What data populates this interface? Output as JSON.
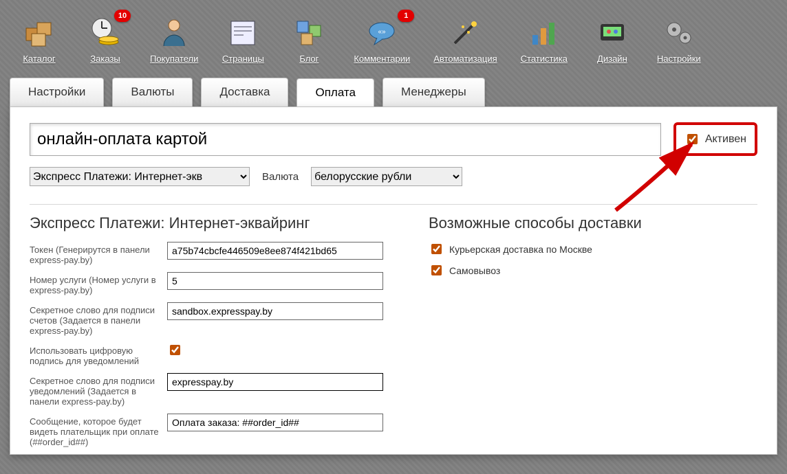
{
  "topnav": [
    {
      "label": "Каталог",
      "badge": null
    },
    {
      "label": "Заказы",
      "badge": "10"
    },
    {
      "label": "Покупатели",
      "badge": null
    },
    {
      "label": "Страницы",
      "badge": null
    },
    {
      "label": "Блог",
      "badge": null
    },
    {
      "label": "Комментарии",
      "badge": "1"
    },
    {
      "label": "Автоматизация",
      "badge": null
    },
    {
      "label": "Статистика",
      "badge": null
    },
    {
      "label": "Дизайн",
      "badge": null
    },
    {
      "label": "Настройки",
      "badge": null
    }
  ],
  "tabs": [
    "Настройки",
    "Валюты",
    "Доставка",
    "Оплата",
    "Менеджеры"
  ],
  "active_tab": "Оплата",
  "name_value": "онлайн-оплата картой",
  "active_checkbox": {
    "label": "Активен",
    "checked": true
  },
  "module_select": {
    "options": [
      "Экспресс Платежи: Интернет-экв"
    ],
    "selected": "Экспресс Платежи: Интернет-экв"
  },
  "currency": {
    "label": "Валюта",
    "options": [
      "белорусские рубли"
    ],
    "selected": "белорусские рубли"
  },
  "section_left_title": "Экспресс Платежи: Интернет-эквайринг",
  "fields": {
    "token": {
      "label": "Токен (Генерирутся в панели express-pay.by)",
      "value": "a75b74cbcfe446509e8ee874f421bd65"
    },
    "service": {
      "label": "Номер услуги (Номер услуги в express-pay.by)",
      "value": "5"
    },
    "secret_bill": {
      "label": "Секретное слово для подписи счетов (Задается в панели express-pay.by)",
      "value": "sandbox.expresspay.by"
    },
    "use_sign": {
      "label": "Использовать цифровую подпись для уведомлений",
      "checked": true
    },
    "secret_notify": {
      "label": "Секретное слово для подписи уведомлений (Задается в панели express-pay.by)",
      "value": "expresspay.by"
    },
    "message": {
      "label": "Сообщение, которое будет видеть плательщик при оплате (##order_id##)",
      "value": "Оплата заказа: ##order_id##"
    }
  },
  "section_right_title": "Возможные способы доставки",
  "delivery": [
    {
      "label": "Курьерская доставка по Москве",
      "checked": true
    },
    {
      "label": "Самовывоз",
      "checked": true
    }
  ]
}
